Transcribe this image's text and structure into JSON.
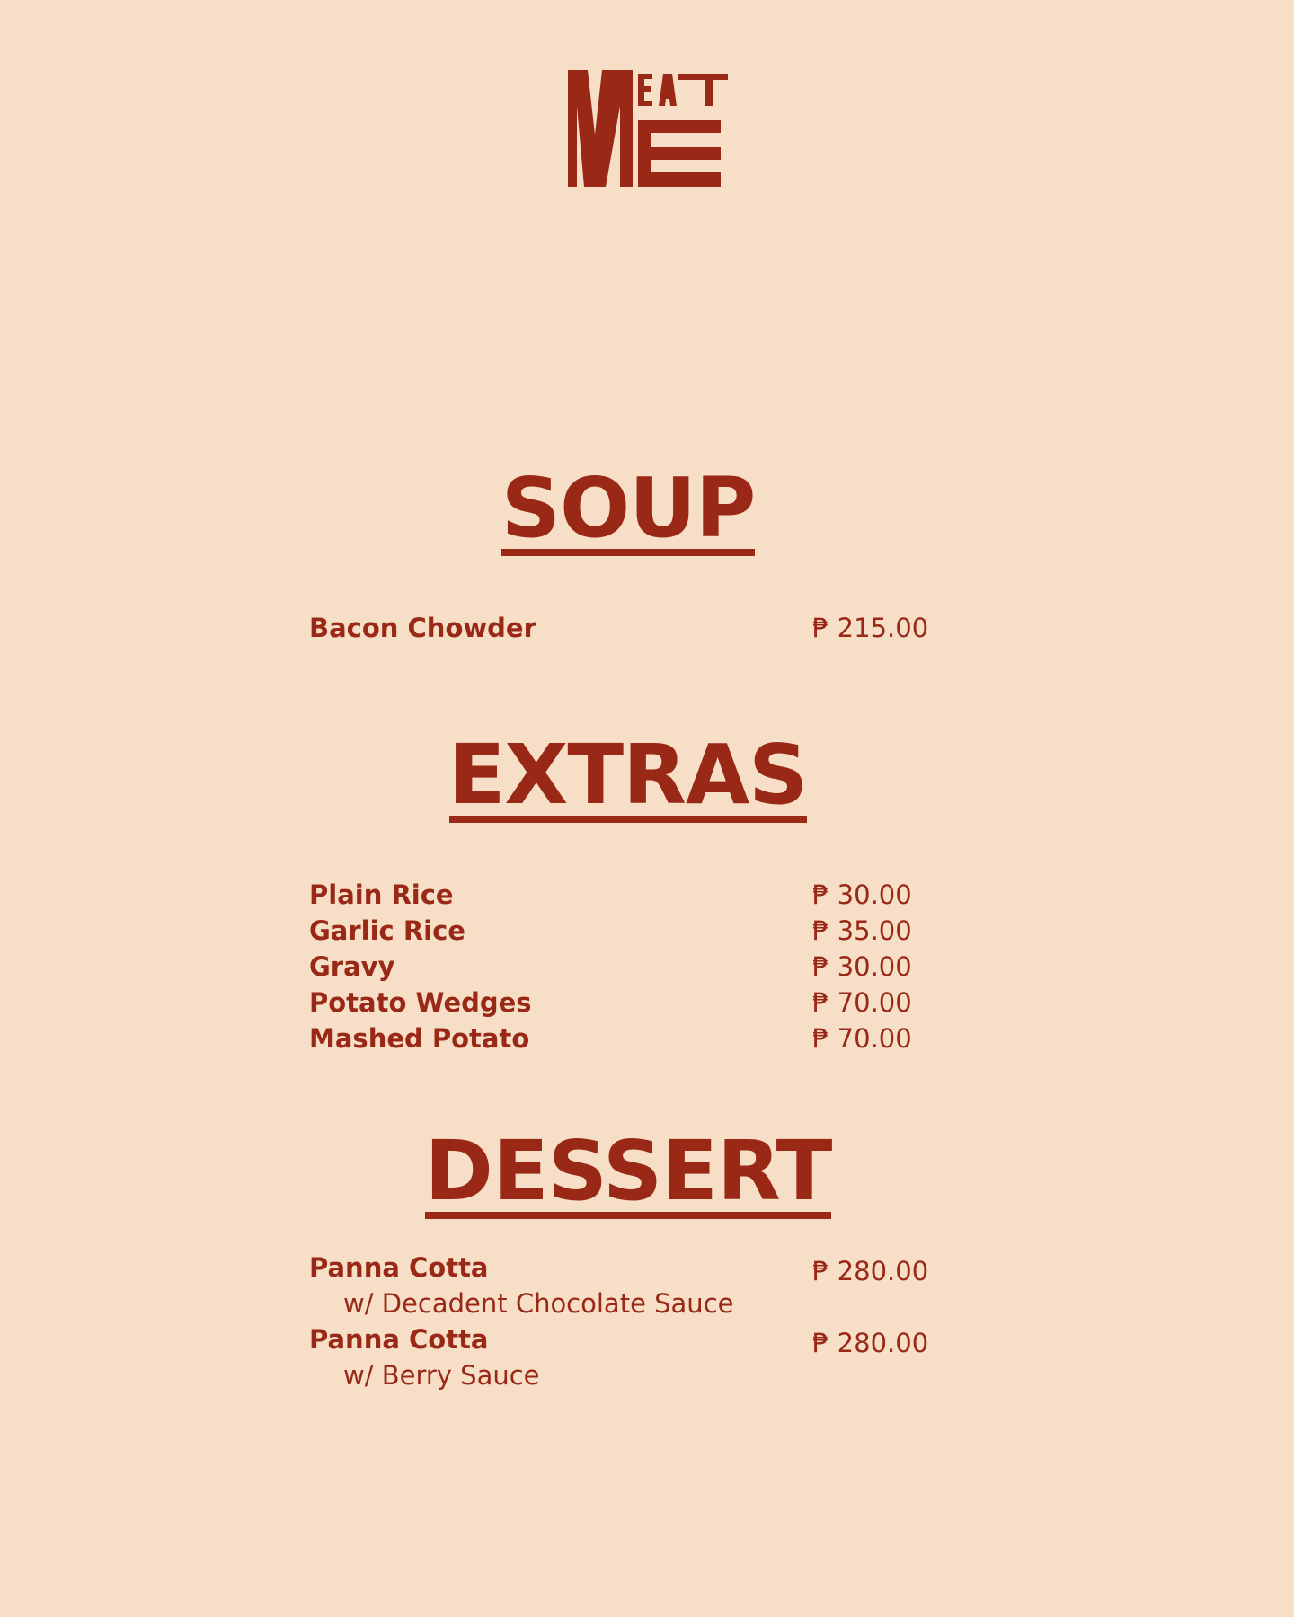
{
  "brand": {
    "logo_name": "MEAT ME",
    "logo_color": "#9a2817",
    "background_color": "#f6dfc6"
  },
  "sections": [
    {
      "title": "SOUP",
      "items": [
        {
          "name": "Bacon Chowder",
          "price": "₱ 215.00"
        }
      ]
    },
    {
      "title": "EXTRAS",
      "items": [
        {
          "name": "Plain Rice",
          "price": "₱ 30.00"
        },
        {
          "name": "Garlic Rice",
          "price": "₱ 35.00"
        },
        {
          "name": "Gravy",
          "price": "₱ 30.00"
        },
        {
          "name": "Potato Wedges",
          "price": "₱ 70.00"
        },
        {
          "name": "Mashed Potato",
          "price": "₱ 70.00"
        }
      ]
    },
    {
      "title": "DESSERT",
      "items": [
        {
          "name": "Panna Cotta",
          "note": "w/ Decadent Chocolate Sauce",
          "price": "₱ 280.00"
        },
        {
          "name": "Panna Cotta",
          "note": "w/ Berry Sauce",
          "price": "₱ 280.00"
        }
      ]
    }
  ]
}
